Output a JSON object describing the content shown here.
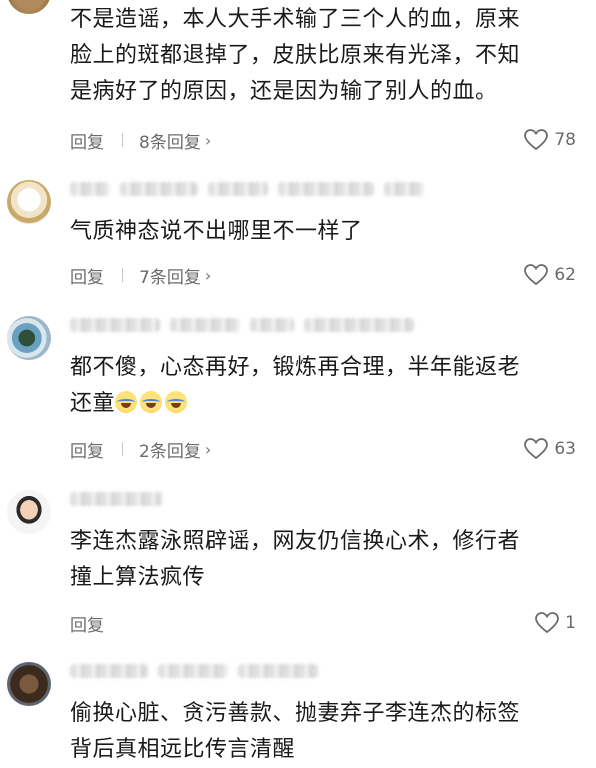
{
  "comments": [
    {
      "text_lines": [
        "不是造谣，本人大手术输了三个人的血，原来",
        "脸上的斑都退掉了，皮肤比原来有光泽，不知",
        "是病好了的原因，还是因为输了别人的血。"
      ],
      "reply_label": "回复",
      "replies_label": "8条回复",
      "likes": "78"
    },
    {
      "text_lines": [
        "气质神态说不出哪里不一样了"
      ],
      "reply_label": "回复",
      "replies_label": "7条回复",
      "likes": "62"
    },
    {
      "text_lines": [
        "都不傻，心态再好，锻炼再合理，半年能返老",
        "还童"
      ],
      "emoji_count": 3,
      "reply_label": "回复",
      "replies_label": "2条回复",
      "likes": "63"
    },
    {
      "text_lines": [
        "李连杰露泳照辟谣，网友仍信换心术，修行者",
        "撞上算法疯传"
      ],
      "reply_label": "回复",
      "likes": "1"
    },
    {
      "text_lines": [
        "偷换心脏、贪污善款、抛妻弃子李连杰的标签",
        "背后真相远比传言清醒"
      ]
    }
  ],
  "icons": {
    "heart": "heart-outline-icon",
    "chevron": "chevron-right-icon",
    "emoji": "laughing-tears-emoji-icon"
  },
  "colors": {
    "text": "#1a1a1a",
    "secondary": "#6b6b6b"
  }
}
